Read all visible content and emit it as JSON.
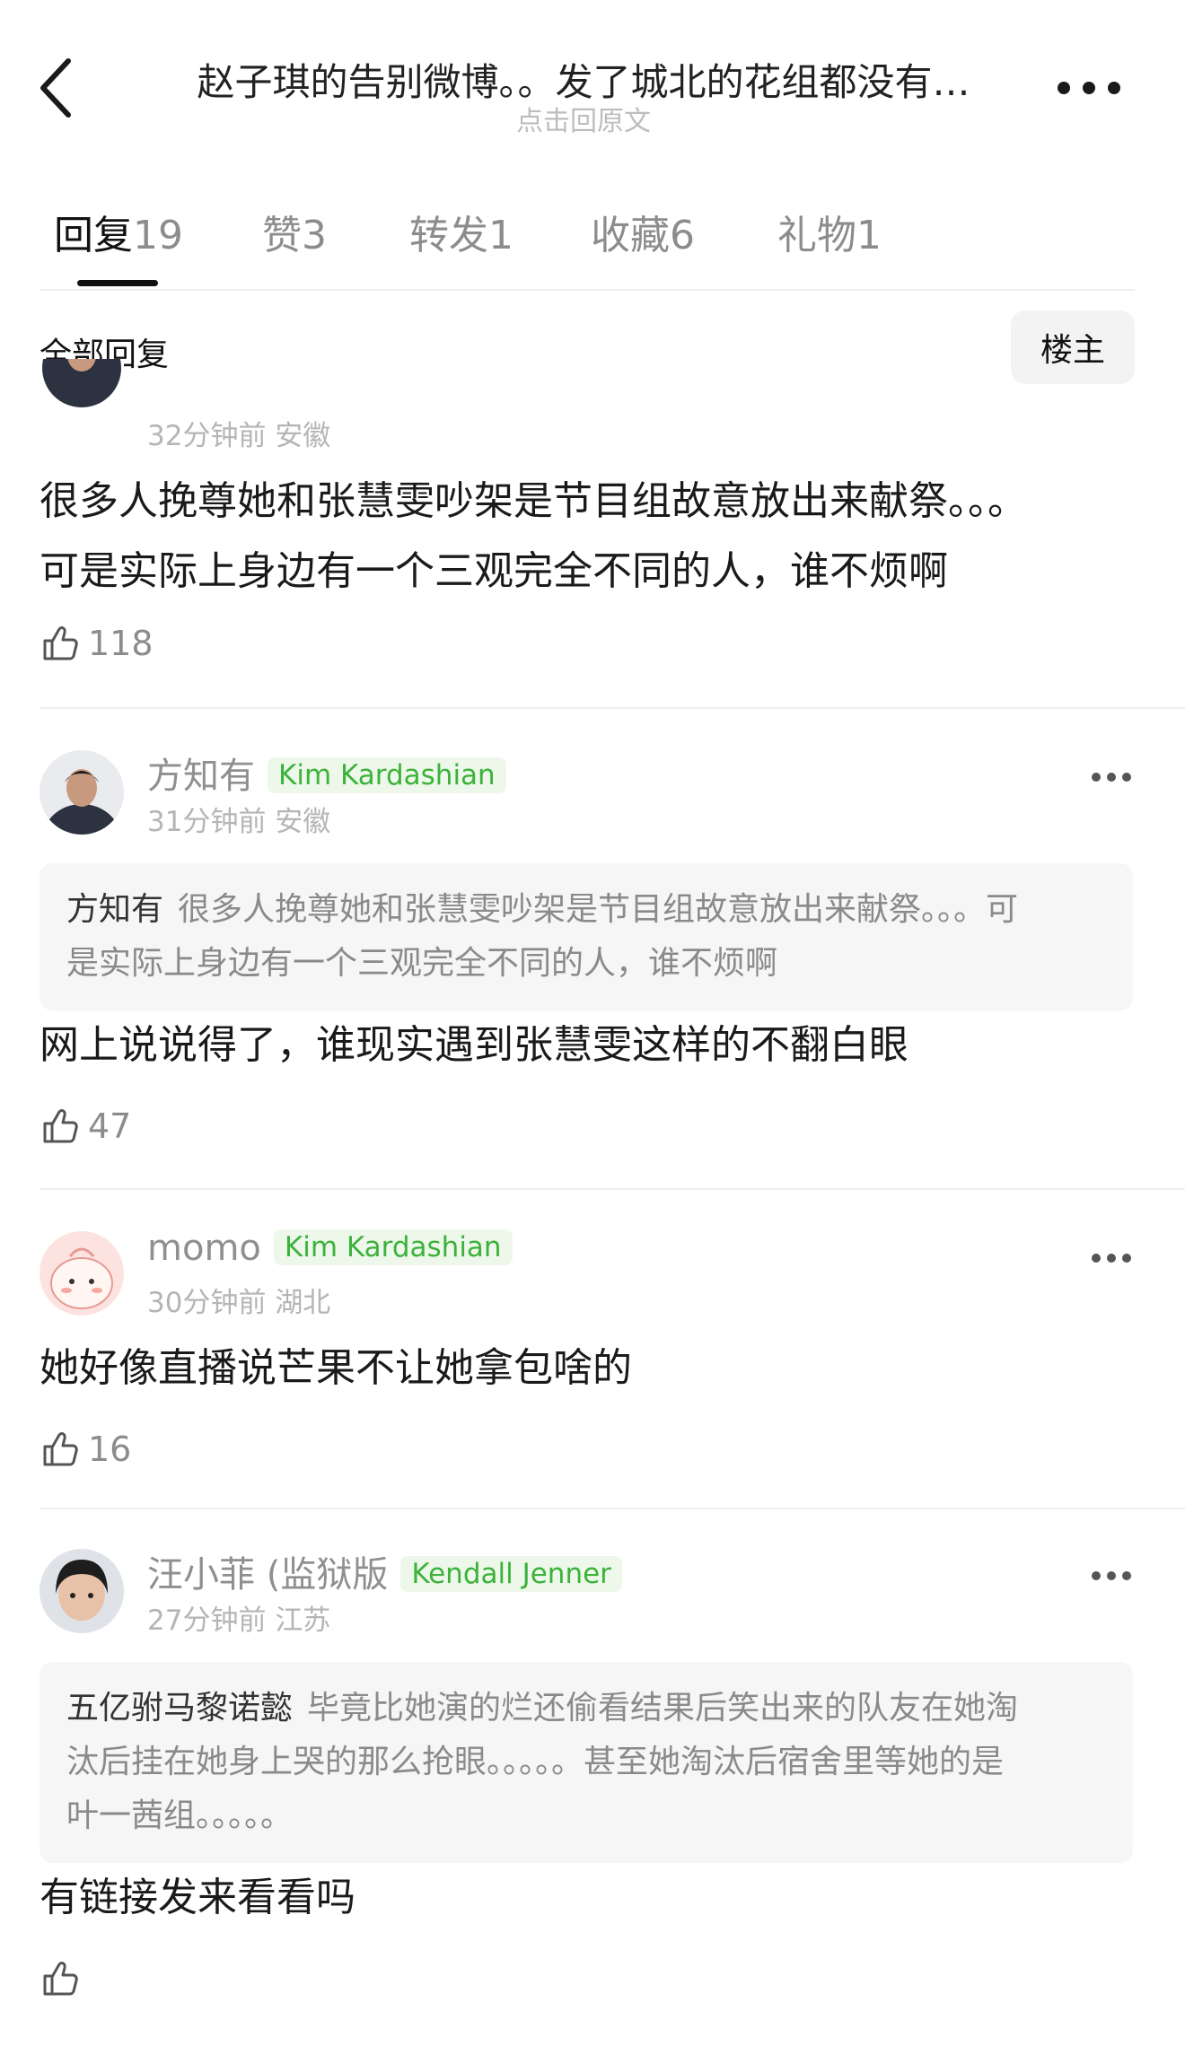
{
  "header": {
    "title": "赵子琪的告别微博。。发了城北的花组都没有…",
    "subtitle": "点击回原文"
  },
  "tabs": [
    {
      "label": "回复",
      "count": "19",
      "active": true
    },
    {
      "label": "赞",
      "count": "3"
    },
    {
      "label": "转发",
      "count": "1"
    },
    {
      "label": "收藏",
      "count": "6"
    },
    {
      "label": "礼物",
      "count": "1"
    }
  ],
  "section": {
    "title": "全部回复",
    "owner_button": "楼主"
  },
  "comments": [
    {
      "time": "32分钟前",
      "location": "安徽",
      "text_lines": [
        "很多人挽尊她和张慧雯吵架是节目组故意放出来献祭。。。",
        "可是实际上身边有一个三观完全不同的人，谁不烦啊"
      ],
      "likes": "118"
    },
    {
      "user": "方知有",
      "badge": "Kim Kardashian",
      "time": "31分钟前",
      "location": "安徽",
      "quote_user": "方知有",
      "quote_lines": [
        "很多人挽尊她和张慧雯吵架是节目组故意放出来献祭。。。可",
        "是实际上身边有一个三观完全不同的人，谁不烦啊"
      ],
      "text": "网上说说得了，谁现实遇到张慧雯这样的不翻白眼",
      "likes": "47"
    },
    {
      "user": "momo",
      "badge": "Kim Kardashian",
      "time": "30分钟前",
      "location": "湖北",
      "text": "她好像直播说芒果不让她拿包啥的",
      "likes": "16"
    },
    {
      "user": "汪小菲 (监狱版",
      "badge": "Kendall Jenner",
      "time": "27分钟前",
      "location": "江苏",
      "quote_user": "五亿驸马黎诺懿",
      "quote_lines": [
        "毕竟比她演的烂还偷看结果后笑出来的队友在她淘",
        "汰后挂在她身上哭的那么抢眼。。。。。甚至她淘汰后宿舍里等她的是",
        "叶一茜组。。。。。"
      ],
      "text": "有链接发来看看吗",
      "likes": ""
    }
  ],
  "colors": {
    "badge_green": "#3cb23c",
    "badge_bg": "#eef8ea",
    "muted": "#8c8c8c"
  },
  "icons": [
    "back-arrow-icon",
    "more-dots-icon",
    "thumbs-up-icon"
  ]
}
